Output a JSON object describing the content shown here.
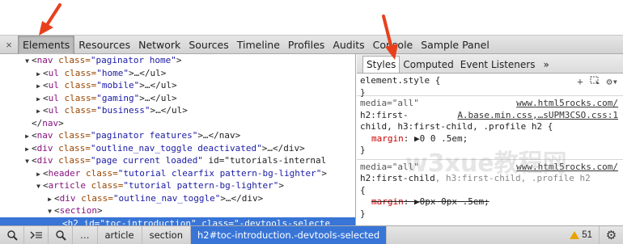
{
  "devtools": {
    "close_icon": "×",
    "main_tabs": [
      {
        "label": "Elements",
        "selected": true
      },
      {
        "label": "Resources"
      },
      {
        "label": "Network"
      },
      {
        "label": "Sources"
      },
      {
        "label": "Timeline"
      },
      {
        "label": "Profiles"
      },
      {
        "label": "Audits"
      },
      {
        "label": "Console"
      },
      {
        "label": "Sample Panel"
      }
    ],
    "dom_tree": [
      {
        "tri": "▼",
        "pre": "<",
        "tag": "nav",
        "a1": " class=",
        "v1": "\"paginator home\"",
        "post": ">"
      },
      {
        "tri": "▶",
        "pre": "<",
        "tag": "ul",
        "a1": " class=",
        "v1": "\"home\"",
        "post": ">…</ul>"
      },
      {
        "tri": "▶",
        "pre": "<",
        "tag": "ul",
        "a1": " class=",
        "v1": "\"mobile\"",
        "post": ">…</ul>"
      },
      {
        "tri": "▶",
        "pre": "<",
        "tag": "ul",
        "a1": " class=",
        "v1": "\"gaming\"",
        "post": ">…</ul>"
      },
      {
        "tri": "▶",
        "pre": "<",
        "tag": "ul",
        "a1": " class=",
        "v1": "\"business\"",
        "post": ">…</ul>"
      },
      {
        "tri": "",
        "pre": "</",
        "tag": "nav",
        "a1": "",
        "v1": "",
        "post": ">"
      },
      {
        "tri": "▶",
        "pre": "<",
        "tag": "nav",
        "a1": " class=",
        "v1": "\"paginator features\"",
        "post": ">…</nav>"
      },
      {
        "tri": "▶",
        "pre": "<",
        "tag": "div",
        "a1": " class=",
        "v1": "\"outline_nav_toggle deactivated\"",
        "post": ">…</div>"
      },
      {
        "tri": "▼",
        "pre": "<",
        "tag": "div",
        "a1": " class=",
        "v1": "\"page current loaded\"",
        "post": " id=\"tutorials-internal"
      },
      {
        "tri": "▶",
        "pre": "<",
        "tag": "header",
        "a1": " class=",
        "v1": "\"tutorial clearfix pattern-bg-lighter\"",
        "post": ">"
      },
      {
        "tri": "▼",
        "pre": "<",
        "tag": "article",
        "a1": " class=",
        "v1": "\"tutorial pattern-bg-lighter\"",
        "post": ">"
      },
      {
        "tri": "▶",
        "pre": "<",
        "tag": "div",
        "a1": " class=",
        "v1": "\"outline_nav_toggle\"",
        "post": ">…</div>"
      },
      {
        "tri": "▼",
        "pre": "<",
        "tag": "section",
        "a1": "",
        "v1": "",
        "post": ">"
      },
      {
        "tri": "",
        "pre": "<",
        "tag": "h2",
        "a1": " id=",
        "v1": "\"toc-introduction\"",
        "post": " class=\"-devtools-selecte"
      }
    ],
    "sidebar_tabs": [
      "Styles",
      "Computed",
      "Event Listeners"
    ],
    "sidebar_more": "»",
    "styles": {
      "element_style": "element.style {",
      "close_brace": "}",
      "rule1": {
        "media": "media=\"all\"",
        "source_url": "www.html5rocks.com/",
        "selector_line1": "h2:first-",
        "source_file": "A.base.min.css,…sUPM3CSO.css:1",
        "selector_line2": "child, h3:first-child, .profile h2 {",
        "prop": "margin",
        "value": "0 0 .5em;"
      },
      "rule2": {
        "media": "media=\"all\"",
        "source_url": "www.html5rocks.com/",
        "selector_main": "h2:first-child",
        "selector_rest": ", h3:first-child, .profile h2",
        "open": "{",
        "prop": "margin",
        "value": "0px 0px .5em;"
      }
    },
    "breadcrumbs": [
      "article",
      "section",
      "h2#toc-introduction.-devtools-selected"
    ],
    "ellipsis": "…",
    "warnings_count": "51",
    "watermark": "w3xue教程网"
  },
  "accent": "#3875d7",
  "arrow_color": "#e8401c"
}
